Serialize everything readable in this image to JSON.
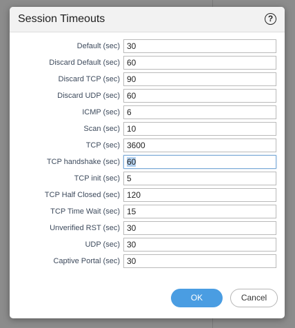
{
  "dialog": {
    "title": "Session Timeouts",
    "help_icon": "?"
  },
  "fields": [
    {
      "label": "Default (sec)",
      "value": "30"
    },
    {
      "label": "Discard Default (sec)",
      "value": "60"
    },
    {
      "label": "Discard TCP (sec)",
      "value": "90"
    },
    {
      "label": "Discard UDP (sec)",
      "value": "60"
    },
    {
      "label": "ICMP (sec)",
      "value": "6"
    },
    {
      "label": "Scan (sec)",
      "value": "10"
    },
    {
      "label": "TCP (sec)",
      "value": "3600"
    },
    {
      "label": "TCP handshake (sec)",
      "value": "60",
      "focused": true,
      "selected": true
    },
    {
      "label": "TCP init (sec)",
      "value": "5"
    },
    {
      "label": "TCP Half Closed (sec)",
      "value": "120"
    },
    {
      "label": "TCP Time Wait (sec)",
      "value": "15"
    },
    {
      "label": "Unverified RST (sec)",
      "value": "30"
    },
    {
      "label": "UDP (sec)",
      "value": "30"
    },
    {
      "label": "Captive Portal (sec)",
      "value": "30"
    }
  ],
  "buttons": {
    "ok": "OK",
    "cancel": "Cancel"
  },
  "colors": {
    "primary_button": "#4a9de2",
    "label_text": "#3d4a5c",
    "focus_border": "#7aa9d6"
  }
}
